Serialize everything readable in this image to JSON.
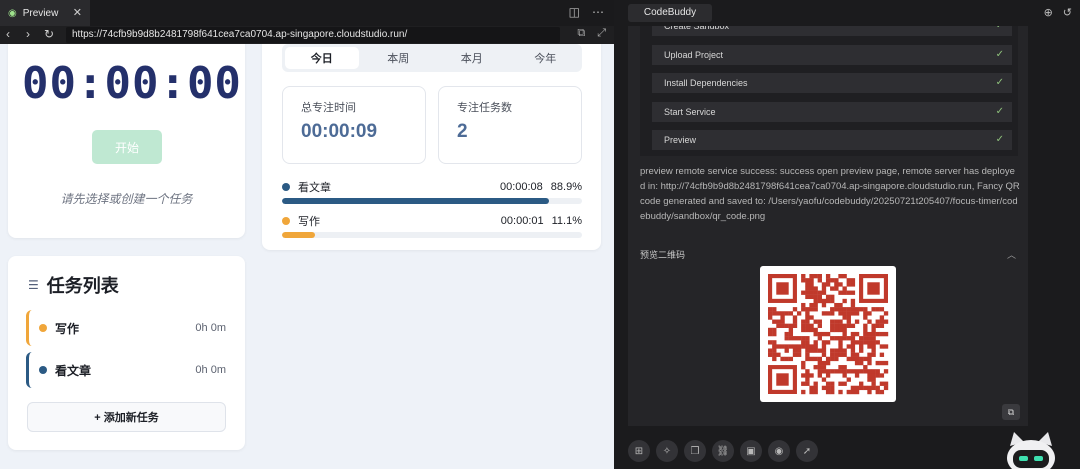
{
  "preview": {
    "tab_label": "Preview",
    "close_glyph": "✕",
    "tab_icons": [
      "split-icon",
      "more-icon"
    ],
    "url": "https://74cfb9b9d8b2481798f641cea7ca0704.ap-singapore.cloudstudio.run/"
  },
  "app": {
    "timer": "00:00:00",
    "start_label": "开始",
    "hint": "请先选择或创建一个任务",
    "periods": [
      "今日",
      "本周",
      "本月",
      "今年"
    ],
    "active_period": "今日",
    "stats": {
      "total_time_label": "总专注时间",
      "total_time_value": "00:00:09",
      "task_count_label": "专注任务数",
      "task_count_value": "2"
    },
    "breakdown": [
      {
        "name": "看文章",
        "time": "00:00:08",
        "percent": "88.9%",
        "fraction": 0.889,
        "color": "#2b5a84"
      },
      {
        "name": "写作",
        "time": "00:00:01",
        "percent": "11.1%",
        "fraction": 0.111,
        "color": "#f0a63a"
      }
    ],
    "task_list": {
      "title": "任务列表",
      "tasks": [
        {
          "name": "写作",
          "duration": "0h 0m",
          "color": "#f0a63a"
        },
        {
          "name": "看文章",
          "duration": "0h 0m",
          "color": "#2b5a84"
        }
      ],
      "add_label": "+ 添加新任务"
    }
  },
  "codebuddy": {
    "tab_label": "CodeBuddy",
    "steps": [
      "Create Sandbox",
      "Upload Project",
      "Install Dependencies",
      "Start Service",
      "Preview"
    ],
    "log": "preview remote service success: success open preview page, remote server has deployed in: http://74cfb9b9d8b2481798f641cea7ca0704.ap-singapore.cloudstudio.run, Fancy QR code generated and saved to: /Users/yaofu/codebuddy/20250721t205407/focus-timer/codebuddy/sandbox/qr_code.png",
    "qr_label": "预览二维码",
    "qr_color": "#c0392b",
    "toolbar_icons": [
      "grid-icon",
      "sparkle-icon",
      "blocks-icon",
      "link-icon",
      "image-icon",
      "eye-icon",
      "rocket-icon"
    ]
  }
}
